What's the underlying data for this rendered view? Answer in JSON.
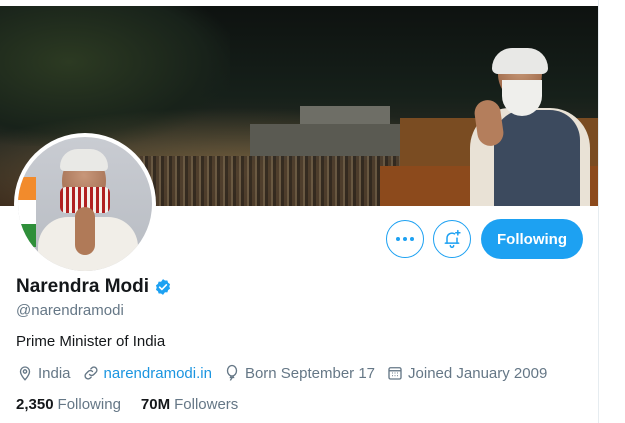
{
  "profile": {
    "name": "Narendra Modi",
    "handle": "@narendramodi",
    "bio": "Prime Minister of India",
    "location": "India",
    "website": "narendramodi.in",
    "birthday": "Born September 17",
    "joined": "Joined January 2009",
    "following_count": "2,350",
    "following_label": "Following",
    "followers_count": "70M",
    "followers_label": "Followers",
    "verified": true
  },
  "actions": {
    "more_icon": "more-dots-icon",
    "notify_icon": "bell-plus-icon",
    "follow_button_label": "Following"
  },
  "colors": {
    "accent": "#1da1f2",
    "link": "#1b95e0",
    "secondary_text": "#657786"
  },
  "icons": {
    "location": "map-pin-icon",
    "website": "link-icon",
    "birthday": "balloon-icon",
    "joined": "calendar-icon",
    "verified": "verified-badge-icon"
  }
}
